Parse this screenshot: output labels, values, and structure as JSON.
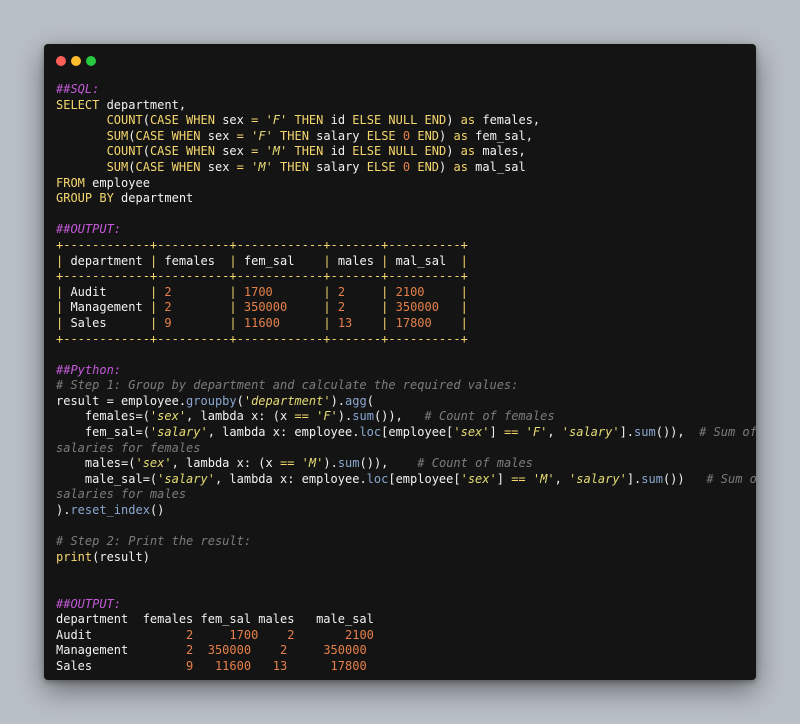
{
  "colors": {
    "background": "#b9bfc6",
    "window": "#141414",
    "comment": "#7c7c7c",
    "section_header": "#c45ad8",
    "keyword": "#f5d76e",
    "string": "#e6db74",
    "number": "#e5804a",
    "function": "#8aa7d0",
    "text": "#f2f2f2"
  },
  "lines": [
    [
      {
        "t": "##SQL:",
        "c": "header"
      }
    ],
    [
      {
        "t": "SELECT",
        "c": "kw"
      },
      {
        "t": " department,",
        "c": "plain"
      }
    ],
    [
      {
        "t": "       ",
        "c": "plain"
      },
      {
        "t": "COUNT",
        "c": "kw"
      },
      {
        "t": "(",
        "c": "plain"
      },
      {
        "t": "CASE WHEN",
        "c": "kw"
      },
      {
        "t": " sex ",
        "c": "plain"
      },
      {
        "t": "=",
        "c": "kw"
      },
      {
        "t": " ",
        "c": "plain"
      },
      {
        "t": "'F'",
        "c": "str"
      },
      {
        "t": " ",
        "c": "plain"
      },
      {
        "t": "THEN",
        "c": "kw"
      },
      {
        "t": " id ",
        "c": "plain"
      },
      {
        "t": "ELSE NULL END",
        "c": "kw"
      },
      {
        "t": ") ",
        "c": "plain"
      },
      {
        "t": "as",
        "c": "kw"
      },
      {
        "t": " females,",
        "c": "plain"
      }
    ],
    [
      {
        "t": "       ",
        "c": "plain"
      },
      {
        "t": "SUM",
        "c": "kw"
      },
      {
        "t": "(",
        "c": "plain"
      },
      {
        "t": "CASE WHEN",
        "c": "kw"
      },
      {
        "t": " sex ",
        "c": "plain"
      },
      {
        "t": "=",
        "c": "kw"
      },
      {
        "t": " ",
        "c": "plain"
      },
      {
        "t": "'F'",
        "c": "str"
      },
      {
        "t": " ",
        "c": "plain"
      },
      {
        "t": "THEN",
        "c": "kw"
      },
      {
        "t": " salary ",
        "c": "plain"
      },
      {
        "t": "ELSE",
        "c": "kw"
      },
      {
        "t": " ",
        "c": "plain"
      },
      {
        "t": "0",
        "c": "num"
      },
      {
        "t": " ",
        "c": "plain"
      },
      {
        "t": "END",
        "c": "kw"
      },
      {
        "t": ") ",
        "c": "plain"
      },
      {
        "t": "as",
        "c": "kw"
      },
      {
        "t": " fem_sal,",
        "c": "plain"
      }
    ],
    [
      {
        "t": "       ",
        "c": "plain"
      },
      {
        "t": "COUNT",
        "c": "kw"
      },
      {
        "t": "(",
        "c": "plain"
      },
      {
        "t": "CASE WHEN",
        "c": "kw"
      },
      {
        "t": " sex ",
        "c": "plain"
      },
      {
        "t": "=",
        "c": "kw"
      },
      {
        "t": " ",
        "c": "plain"
      },
      {
        "t": "'M'",
        "c": "str"
      },
      {
        "t": " ",
        "c": "plain"
      },
      {
        "t": "THEN",
        "c": "kw"
      },
      {
        "t": " id ",
        "c": "plain"
      },
      {
        "t": "ELSE NULL END",
        "c": "kw"
      },
      {
        "t": ") ",
        "c": "plain"
      },
      {
        "t": "as",
        "c": "kw"
      },
      {
        "t": " males,",
        "c": "plain"
      }
    ],
    [
      {
        "t": "       ",
        "c": "plain"
      },
      {
        "t": "SUM",
        "c": "kw"
      },
      {
        "t": "(",
        "c": "plain"
      },
      {
        "t": "CASE WHEN",
        "c": "kw"
      },
      {
        "t": " sex ",
        "c": "plain"
      },
      {
        "t": "=",
        "c": "kw"
      },
      {
        "t": " ",
        "c": "plain"
      },
      {
        "t": "'M'",
        "c": "str"
      },
      {
        "t": " ",
        "c": "plain"
      },
      {
        "t": "THEN",
        "c": "kw"
      },
      {
        "t": " salary ",
        "c": "plain"
      },
      {
        "t": "ELSE",
        "c": "kw"
      },
      {
        "t": " ",
        "c": "plain"
      },
      {
        "t": "0",
        "c": "num"
      },
      {
        "t": " ",
        "c": "plain"
      },
      {
        "t": "END",
        "c": "kw"
      },
      {
        "t": ") ",
        "c": "plain"
      },
      {
        "t": "as",
        "c": "kw"
      },
      {
        "t": " mal_sal",
        "c": "plain"
      }
    ],
    [
      {
        "t": "FROM",
        "c": "kw"
      },
      {
        "t": " employee",
        "c": "plain"
      }
    ],
    [
      {
        "t": "GROUP BY",
        "c": "kw"
      },
      {
        "t": " department",
        "c": "plain"
      }
    ],
    [],
    [
      {
        "t": "##OUTPUT:",
        "c": "header"
      }
    ],
    [
      {
        "t": "+------------+----------+------------+-------+----------+",
        "c": "kw"
      }
    ],
    [
      {
        "t": "|",
        "c": "kw"
      },
      {
        "t": " department ",
        "c": "plain"
      },
      {
        "t": "|",
        "c": "kw"
      },
      {
        "t": " females  ",
        "c": "plain"
      },
      {
        "t": "|",
        "c": "kw"
      },
      {
        "t": " fem_sal    ",
        "c": "plain"
      },
      {
        "t": "|",
        "c": "kw"
      },
      {
        "t": " males ",
        "c": "plain"
      },
      {
        "t": "|",
        "c": "kw"
      },
      {
        "t": " mal_sal  ",
        "c": "plain"
      },
      {
        "t": "|",
        "c": "kw"
      }
    ],
    [
      {
        "t": "+------------+----------+------------+-------+----------+",
        "c": "kw"
      }
    ],
    [
      {
        "t": "|",
        "c": "kw"
      },
      {
        "t": " Audit      ",
        "c": "plain"
      },
      {
        "t": "|",
        "c": "kw"
      },
      {
        "t": " 2        ",
        "c": "num"
      },
      {
        "t": "|",
        "c": "kw"
      },
      {
        "t": " 1700       ",
        "c": "num"
      },
      {
        "t": "|",
        "c": "kw"
      },
      {
        "t": " 2     ",
        "c": "num"
      },
      {
        "t": "|",
        "c": "kw"
      },
      {
        "t": " 2100     ",
        "c": "num"
      },
      {
        "t": "|",
        "c": "kw"
      }
    ],
    [
      {
        "t": "|",
        "c": "kw"
      },
      {
        "t": " Management ",
        "c": "plain"
      },
      {
        "t": "|",
        "c": "kw"
      },
      {
        "t": " 2        ",
        "c": "num"
      },
      {
        "t": "|",
        "c": "kw"
      },
      {
        "t": " 350000     ",
        "c": "num"
      },
      {
        "t": "|",
        "c": "kw"
      },
      {
        "t": " 2     ",
        "c": "num"
      },
      {
        "t": "|",
        "c": "kw"
      },
      {
        "t": " 350000   ",
        "c": "num"
      },
      {
        "t": "|",
        "c": "kw"
      }
    ],
    [
      {
        "t": "|",
        "c": "kw"
      },
      {
        "t": " Sales      ",
        "c": "plain"
      },
      {
        "t": "|",
        "c": "kw"
      },
      {
        "t": " 9        ",
        "c": "num"
      },
      {
        "t": "|",
        "c": "kw"
      },
      {
        "t": " 11600      ",
        "c": "num"
      },
      {
        "t": "|",
        "c": "kw"
      },
      {
        "t": " 13    ",
        "c": "num"
      },
      {
        "t": "|",
        "c": "kw"
      },
      {
        "t": " 17800    ",
        "c": "num"
      },
      {
        "t": "|",
        "c": "kw"
      }
    ],
    [
      {
        "t": "+------------+----------+------------+-------+----------+",
        "c": "kw"
      }
    ],
    [],
    [
      {
        "t": "##Python:",
        "c": "header"
      }
    ],
    [
      {
        "t": "# Step 1: Group by department and calculate the required values:",
        "c": "comment"
      }
    ],
    [
      {
        "t": "result = employee.",
        "c": "plain"
      },
      {
        "t": "groupby",
        "c": "fn"
      },
      {
        "t": "(",
        "c": "plain"
      },
      {
        "t": "'department'",
        "c": "str"
      },
      {
        "t": ").",
        "c": "plain"
      },
      {
        "t": "agg",
        "c": "fn"
      },
      {
        "t": "(",
        "c": "plain"
      }
    ],
    [
      {
        "t": "    females=(",
        "c": "plain"
      },
      {
        "t": "'sex'",
        "c": "str"
      },
      {
        "t": ", lambda x: (x ",
        "c": "plain"
      },
      {
        "t": "==",
        "c": "kw"
      },
      {
        "t": " ",
        "c": "plain"
      },
      {
        "t": "'F'",
        "c": "str"
      },
      {
        "t": ").",
        "c": "plain"
      },
      {
        "t": "sum",
        "c": "fn"
      },
      {
        "t": "()),   ",
        "c": "plain"
      },
      {
        "t": "# Count of females",
        "c": "comment"
      }
    ],
    [
      {
        "t": "    fem_sal=(",
        "c": "plain"
      },
      {
        "t": "'salary'",
        "c": "str"
      },
      {
        "t": ", lambda x: employee.",
        "c": "plain"
      },
      {
        "t": "loc",
        "c": "fn"
      },
      {
        "t": "[employee[",
        "c": "plain"
      },
      {
        "t": "'sex'",
        "c": "str"
      },
      {
        "t": "] ",
        "c": "plain"
      },
      {
        "t": "==",
        "c": "kw"
      },
      {
        "t": " ",
        "c": "plain"
      },
      {
        "t": "'F'",
        "c": "str"
      },
      {
        "t": ", ",
        "c": "plain"
      },
      {
        "t": "'salary'",
        "c": "str"
      },
      {
        "t": "].",
        "c": "plain"
      },
      {
        "t": "sum",
        "c": "fn"
      },
      {
        "t": "()),  ",
        "c": "plain"
      },
      {
        "t": "# Sum of",
        "c": "comment"
      }
    ],
    [
      {
        "t": "salaries for females",
        "c": "comment"
      }
    ],
    [
      {
        "t": "    males=(",
        "c": "plain"
      },
      {
        "t": "'sex'",
        "c": "str"
      },
      {
        "t": ", lambda x: (x ",
        "c": "plain"
      },
      {
        "t": "==",
        "c": "kw"
      },
      {
        "t": " ",
        "c": "plain"
      },
      {
        "t": "'M'",
        "c": "str"
      },
      {
        "t": ").",
        "c": "plain"
      },
      {
        "t": "sum",
        "c": "fn"
      },
      {
        "t": "()),    ",
        "c": "plain"
      },
      {
        "t": "# Count of males",
        "c": "comment"
      }
    ],
    [
      {
        "t": "    male_sal=(",
        "c": "plain"
      },
      {
        "t": "'salary'",
        "c": "str"
      },
      {
        "t": ", lambda x: employee.",
        "c": "plain"
      },
      {
        "t": "loc",
        "c": "fn"
      },
      {
        "t": "[employee[",
        "c": "plain"
      },
      {
        "t": "'sex'",
        "c": "str"
      },
      {
        "t": "] ",
        "c": "plain"
      },
      {
        "t": "==",
        "c": "kw"
      },
      {
        "t": " ",
        "c": "plain"
      },
      {
        "t": "'M'",
        "c": "str"
      },
      {
        "t": ", ",
        "c": "plain"
      },
      {
        "t": "'salary'",
        "c": "str"
      },
      {
        "t": "].",
        "c": "plain"
      },
      {
        "t": "sum",
        "c": "fn"
      },
      {
        "t": "())   ",
        "c": "plain"
      },
      {
        "t": "# Sum of",
        "c": "comment"
      }
    ],
    [
      {
        "t": "salaries for males",
        "c": "comment"
      }
    ],
    [
      {
        "t": ").",
        "c": "plain"
      },
      {
        "t": "reset_index",
        "c": "fn"
      },
      {
        "t": "()",
        "c": "plain"
      }
    ],
    [],
    [
      {
        "t": "# Step 2: Print the result:",
        "c": "comment"
      }
    ],
    [
      {
        "t": "print",
        "c": "kw"
      },
      {
        "t": "(result)",
        "c": "plain"
      }
    ],
    [],
    [],
    [
      {
        "t": "##OUTPUT:",
        "c": "header"
      }
    ],
    [
      {
        "t": "department  females fem_sal males   male_sal",
        "c": "plain"
      }
    ],
    [
      {
        "t": "Audit             ",
        "c": "plain"
      },
      {
        "t": "2     1700    2       2100",
        "c": "num"
      }
    ],
    [
      {
        "t": "Management        ",
        "c": "plain"
      },
      {
        "t": "2  350000    2     350000",
        "c": "num"
      }
    ],
    [
      {
        "t": "Sales             ",
        "c": "plain"
      },
      {
        "t": "9   11600   13      17800",
        "c": "num"
      }
    ]
  ]
}
